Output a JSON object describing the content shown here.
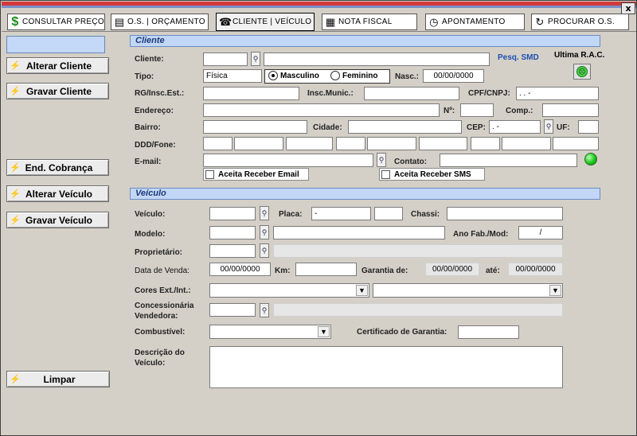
{
  "close_label": "x",
  "tabs": [
    {
      "icon": "dollar-icon",
      "glyph": "$",
      "label": "CONSULTAR PREÇO"
    },
    {
      "icon": "document-icon",
      "glyph": "▤",
      "label": "O.S. | ORÇAMENTO"
    },
    {
      "icon": "car-icon",
      "glyph": "☎",
      "label": "CLIENTE | VEÍCULO"
    },
    {
      "icon": "printer-icon",
      "glyph": "▦",
      "label": "NOTA FISCAL"
    },
    {
      "icon": "clock-icon",
      "glyph": "◷",
      "label": "APONTAMENTO"
    },
    {
      "icon": "refresh-icon",
      "glyph": "↻",
      "label": "PROCURAR O.S."
    }
  ],
  "sidebar": {
    "alterar_cliente": "Alterar Cliente",
    "gravar_cliente": "Gravar Cliente",
    "end_cobranca": "End. Cobrança",
    "alterar_veiculo": "Alterar Veículo",
    "gravar_veiculo": "Gravar Veículo",
    "limpar": "Limpar"
  },
  "cliente": {
    "section_title": "Cliente",
    "cliente_label": "Cliente:",
    "pesq_smd": "Pesq. SMD",
    "ultima_rac": "Ultima R.A.C.",
    "tipo_label": "Tipo:",
    "tipo_value": "Física",
    "masculino": "Masculino",
    "feminino": "Feminino",
    "nasc_label": "Nasc.:",
    "nasc_value": "00/00/0000",
    "rg_label": "RG/Insc.Est.:",
    "insc_munic_label": "Insc.Munic.:",
    "cpf_label": "CPF/CNPJ:",
    "cpf_value": " .   .   -",
    "endereco_label": "Endereço:",
    "numero_label": "Nº:",
    "comp_label": "Comp.:",
    "bairro_label": "Bairro:",
    "cidade_label": "Cidade:",
    "cep_label": "CEP:",
    "cep_value": " .   -",
    "uf_label": "UF:",
    "ddd_label": "DDD/Fone:",
    "email_label": "E-mail:",
    "contato_label": "Contato:",
    "aceita_email": "Aceita Receber Email",
    "aceita_sms": "Aceita Receber SMS"
  },
  "veiculo": {
    "section_title": "Veículo",
    "veiculo_label": "Veículo:",
    "placa_label": "Placa:",
    "placa_value": "-",
    "chassi_label": "Chassi:",
    "modelo_label": "Modelo:",
    "ano_label": "Ano Fab./Mod:",
    "ano_value": "/",
    "proprietario_label": "Proprietário:",
    "data_venda_label": "Data de Venda:",
    "data_venda_value": "00/00/0000",
    "km_label": "Km:",
    "garantia_de_label": "Garantia de:",
    "garantia_de_value": "00/00/0000",
    "ate_label": "até:",
    "ate_value": "00/00/0000",
    "cores_label": "Cores Ext./Int.:",
    "concessionaria_label_1": "Concessionária",
    "concessionaria_label_2": "Vendedora:",
    "combustivel_label": "Combustível:",
    "certificado_label": "Certificado de Garantia:",
    "descricao_label_1": "Descrição do",
    "descricao_label_2": "Veículo:"
  }
}
